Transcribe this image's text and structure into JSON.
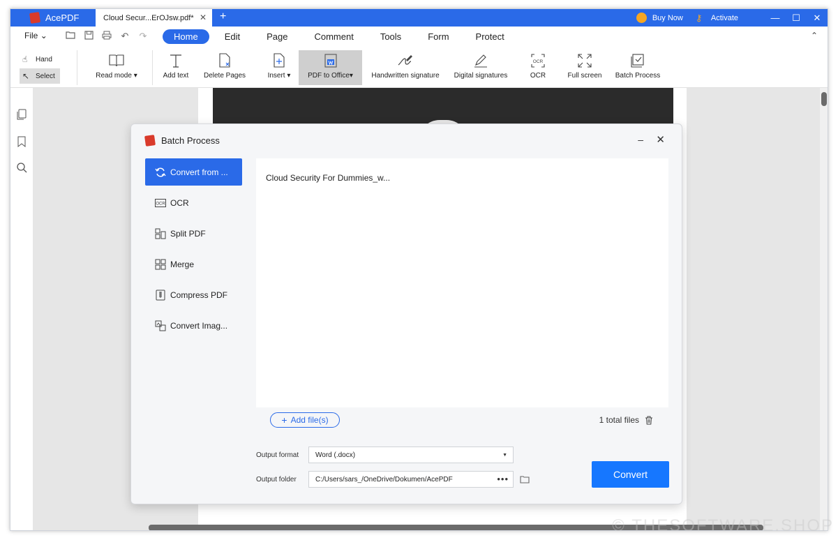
{
  "titlebar": {
    "app_name": "AcePDF",
    "doc_tab": "Cloud Secur...ErOJsw.pdf*",
    "new_tab": "+",
    "buy_now": "Buy Now",
    "activate": "Activate"
  },
  "menu": {
    "file": "File",
    "tabs": [
      "Home",
      "Edit",
      "Page",
      "Comment",
      "Tools",
      "Form",
      "Protect"
    ],
    "active_tab": "Home"
  },
  "ribbon": {
    "hand": "Hand",
    "select": "Select",
    "read_mode": "Read mode",
    "add_text": "Add text",
    "delete_pages": "Delete Pages",
    "insert": "Insert",
    "pdf_to_office": "PDF to Office",
    "handwritten_signature": "Handwritten signature",
    "digital_signatures": "Digital signatures",
    "ocr": "OCR",
    "full_screen": "Full screen",
    "batch_process": "Batch Process"
  },
  "dialog": {
    "title": "Batch Process",
    "nav": [
      {
        "label": "Convert from ...",
        "icon": "convert-icon"
      },
      {
        "label": "OCR",
        "icon": "ocr-icon"
      },
      {
        "label": "Split PDF",
        "icon": "split-icon"
      },
      {
        "label": "Merge",
        "icon": "merge-icon"
      },
      {
        "label": "Compress PDF",
        "icon": "compress-icon"
      },
      {
        "label": "Convert Imag...",
        "icon": "image-convert-icon"
      }
    ],
    "file_name": "Cloud Security For Dummies_w...",
    "add_files": "Add file(s)",
    "total_files": "1 total files",
    "output_format_label": "Output format",
    "output_format_value": "Word (.docx)",
    "output_folder_label": "Output folder",
    "output_folder_value": "C:/Users/sars_/OneDrive/Dokumen/AcePDF",
    "convert": "Convert"
  },
  "watermark": "© THESOFTWARE.SHOP",
  "colors": {
    "accent": "#2a6ae8",
    "convert_button": "#1677ff",
    "logo_red": "#d93a2b",
    "coin": "#f6a623"
  }
}
